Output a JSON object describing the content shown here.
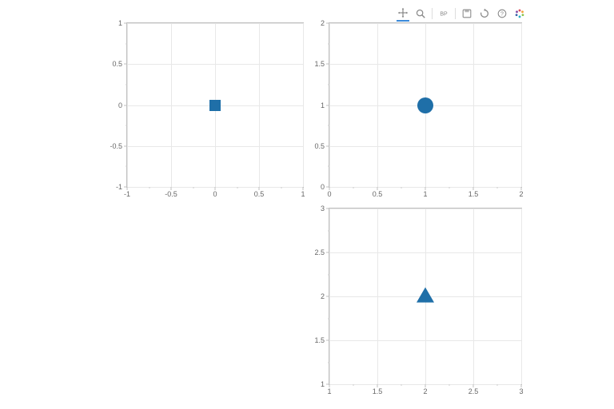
{
  "toolbar": {
    "tools": [
      {
        "name": "pan-tool",
        "active": true
      },
      {
        "name": "box-zoom-tool",
        "active": false
      },
      {
        "name": "box-edit-tool",
        "active": false
      },
      {
        "name": "save-tool",
        "active": false
      },
      {
        "name": "reset-tool",
        "active": false
      },
      {
        "name": "help-tool",
        "active": false
      },
      {
        "name": "bokeh-logo",
        "active": false
      }
    ]
  },
  "chart_data": [
    {
      "id": "panel-top-left",
      "type": "scatter",
      "marker": "square",
      "x": [
        0
      ],
      "y": [
        0
      ],
      "xlim": [
        -1,
        1
      ],
      "ylim": [
        -1,
        1
      ],
      "xticks": [
        -1,
        -0.5,
        0,
        0.5,
        1
      ],
      "yticks": [
        -1,
        -0.5,
        0,
        0.5,
        1
      ],
      "xtick_labels": [
        "-1",
        "-0.5",
        "0",
        "0.5",
        "1"
      ],
      "ytick_labels": [
        "-1",
        "-0.5",
        "0",
        "0.5",
        "1"
      ],
      "color": "#1f6fa8"
    },
    {
      "id": "panel-top-right",
      "type": "scatter",
      "marker": "circle",
      "x": [
        1
      ],
      "y": [
        1
      ],
      "xlim": [
        0,
        2
      ],
      "ylim": [
        0,
        2
      ],
      "xticks": [
        0,
        0.5,
        1,
        1.5,
        2
      ],
      "yticks": [
        0,
        0.5,
        1,
        1.5,
        2
      ],
      "xtick_labels": [
        "0",
        "0.5",
        "1",
        "1.5",
        "2"
      ],
      "ytick_labels": [
        "0",
        "0.5",
        "1",
        "1.5",
        "2"
      ],
      "color": "#1f6fa8"
    },
    {
      "id": "panel-bottom-right",
      "type": "scatter",
      "marker": "triangle",
      "x": [
        2
      ],
      "y": [
        2
      ],
      "xlim": [
        1,
        3
      ],
      "ylim": [
        1,
        3
      ],
      "xticks": [
        1,
        1.5,
        2,
        2.5,
        3
      ],
      "yticks": [
        1,
        1.5,
        2,
        2.5,
        3
      ],
      "xtick_labels": [
        "1",
        "1.5",
        "2",
        "2.5",
        "3"
      ],
      "ytick_labels": [
        "1",
        "1.5",
        "2",
        "2.5",
        "3"
      ],
      "color": "#1f6fa8"
    }
  ],
  "layout": {
    "grid": "2x2",
    "empty_cells": [
      "bottom-left"
    ]
  }
}
